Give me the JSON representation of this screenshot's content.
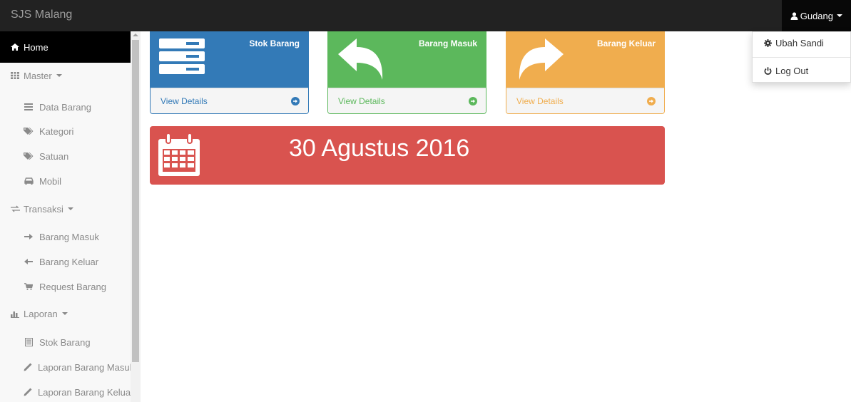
{
  "navbar": {
    "brand": "SJS Malang",
    "user": "Gudang"
  },
  "user_dropdown": {
    "items": [
      {
        "label": "Ubah Sandi",
        "icon": "gear-icon"
      },
      {
        "label": "Log Out",
        "icon": "power-icon"
      }
    ]
  },
  "sidebar": {
    "home": "Home",
    "master": {
      "label": "Master",
      "items": [
        "Data Barang",
        "Kategori",
        "Satuan",
        "Mobil"
      ]
    },
    "transaksi": {
      "label": "Transaksi",
      "items": [
        "Barang Masuk",
        "Barang Keluar",
        "Request Barang"
      ]
    },
    "laporan": {
      "label": "Laporan",
      "items": [
        "Stok Barang",
        "Laporan Barang Masuk",
        "Laporan Barang Keluar"
      ]
    }
  },
  "panels": [
    {
      "title": "Stok Barang",
      "footer": "View Details",
      "color": "#337ab7",
      "icon": "list-icon"
    },
    {
      "title": "Barang Masuk",
      "footer": "View Details",
      "color": "#5cb85c",
      "icon": "reply-arrow-icon"
    },
    {
      "title": "Barang Keluar",
      "footer": "View Details",
      "color": "#f0ad4e",
      "icon": "share-arrow-icon"
    }
  ],
  "date_panel": {
    "date": "30 Agustus 2016",
    "color": "#d9534f",
    "icon": "calendar-icon"
  }
}
